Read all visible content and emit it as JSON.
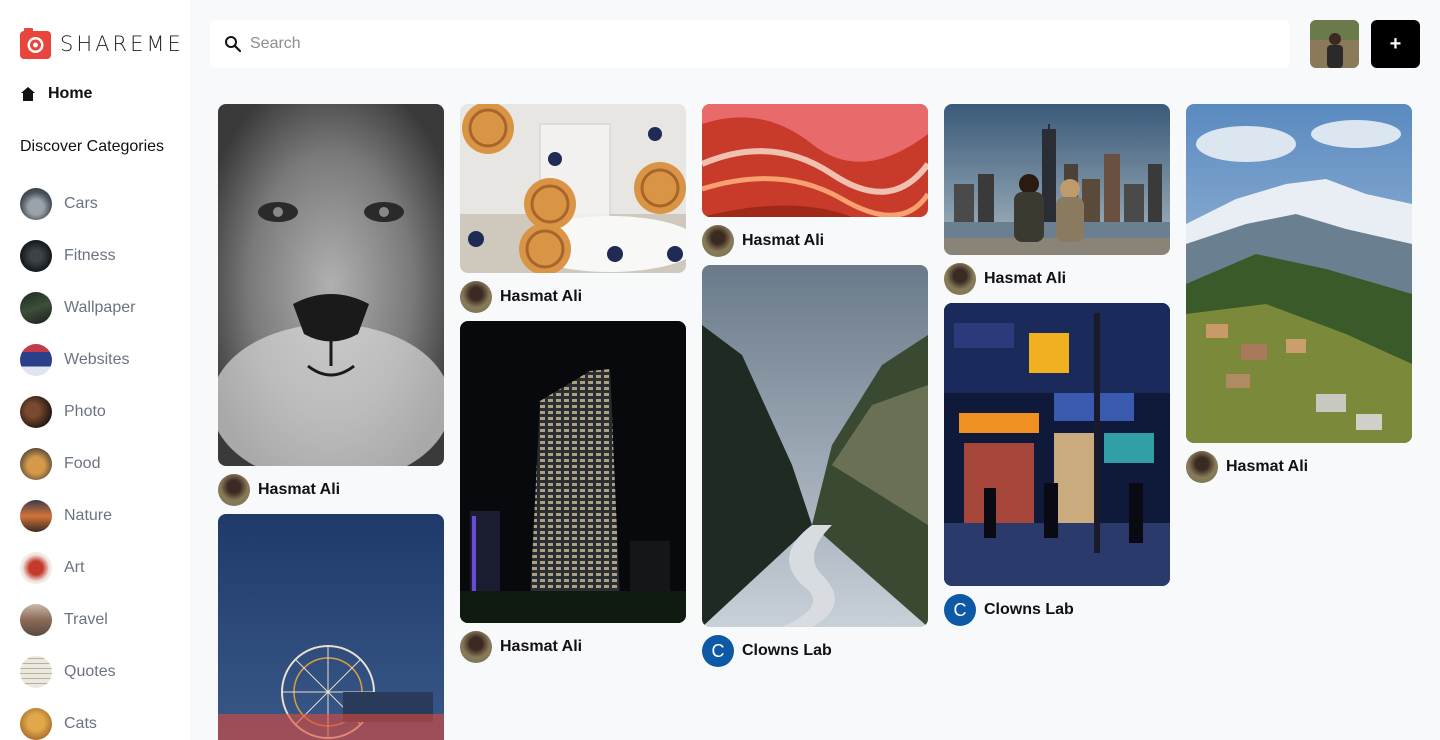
{
  "app": {
    "name": "SHAREME"
  },
  "nav": {
    "home_label": "Home"
  },
  "sidebar": {
    "discover_title": "Discover Categories",
    "categories": [
      {
        "label": "Cars",
        "color": "#5b6670"
      },
      {
        "label": "Fitness",
        "color": "#1f2326"
      },
      {
        "label": "Wallpaper",
        "color": "#2e3a2f"
      },
      {
        "label": "Websites",
        "color": "#2c3b7a"
      },
      {
        "label": "Photo",
        "color": "#3a2a22"
      },
      {
        "label": "Food",
        "color": "#8a6a3a"
      },
      {
        "label": "Nature",
        "color": "#a0603a"
      },
      {
        "label": "Art",
        "color": "#d9c8c0"
      },
      {
        "label": "Travel",
        "color": "#8a7565"
      },
      {
        "label": "Quotes",
        "color": "#e8e4da"
      },
      {
        "label": "Cats",
        "color": "#c58a3a"
      }
    ]
  },
  "search": {
    "placeholder": "Search",
    "value": ""
  },
  "header": {
    "add_label": "+"
  },
  "pins": [
    {
      "author": "Hasmat Ali",
      "avatar": "photo",
      "image": "lion-bw"
    },
    {
      "author": "",
      "avatar": "",
      "image": "ferris-wheel"
    },
    {
      "author": "Hasmat Ali",
      "avatar": "photo",
      "image": "pies-blueberries"
    },
    {
      "author": "Hasmat Ali",
      "avatar": "photo",
      "image": "night-tower"
    },
    {
      "author": "Hasmat Ali",
      "avatar": "photo",
      "image": "red-abstract"
    },
    {
      "author": "Clowns Lab",
      "avatar": "letter",
      "avatar_letter": "C",
      "image": "mountain-river"
    },
    {
      "author": "Hasmat Ali",
      "avatar": "photo",
      "image": "city-skyline-couple"
    },
    {
      "author": "Clowns Lab",
      "avatar": "letter",
      "avatar_letter": "C",
      "image": "night-street-shops"
    },
    {
      "author": "Hasmat Ali",
      "avatar": "photo",
      "image": "mountain-village"
    }
  ],
  "colors": {
    "accent": "#000000",
    "logo_red": "#e8453c",
    "letter_avatar": "#0d59a5"
  }
}
